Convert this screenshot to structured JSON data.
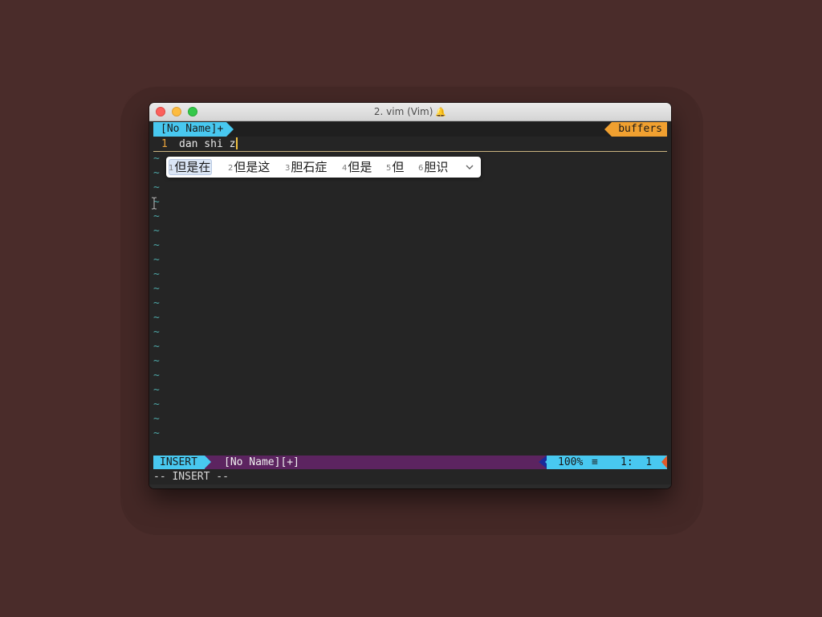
{
  "window": {
    "title": "2. vim (Vim)",
    "bell_icon": "bell-icon"
  },
  "tabline": {
    "active_tab": "[No Name]+",
    "right_label": "buffers"
  },
  "editor": {
    "line_number": "1",
    "line_text": "dan shi z",
    "empty_line_marker": "~",
    "empty_line_count": 20
  },
  "ime": {
    "candidates": [
      {
        "index": "1",
        "text": "但是在",
        "selected": true
      },
      {
        "index": "2",
        "text": "但是这",
        "selected": false
      },
      {
        "index": "3",
        "text": "胆石症",
        "selected": false
      },
      {
        "index": "4",
        "text": "但是",
        "selected": false
      },
      {
        "index": "5",
        "text": "但",
        "selected": false
      },
      {
        "index": "6",
        "text": "胆识",
        "selected": false
      }
    ],
    "expand_icon": "chevron-down-icon"
  },
  "statusline": {
    "mode": "INSERT",
    "filename": "[No Name][+]",
    "percent": "100%",
    "lines_icon": "≡",
    "position": "1:  1"
  },
  "cmdline": {
    "text": "-- INSERT --"
  },
  "colors": {
    "background": "#4a2c2a",
    "accent_cyan": "#48c8f0",
    "accent_orange": "#f0a030",
    "statusline_purple": "#5c2460",
    "tilde": "#4da6a6",
    "line_number": "#e8a33c"
  }
}
